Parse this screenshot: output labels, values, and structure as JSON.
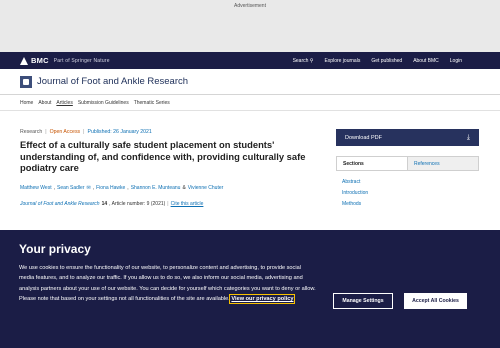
{
  "ad": {
    "label": "Advertisement"
  },
  "topbar": {
    "logo_text": "BMC",
    "logo_sub": "Part of Springer Nature",
    "nav": [
      {
        "label": "Search",
        "icon": "search-icon"
      },
      {
        "label": "Explore journals"
      },
      {
        "label": "Get published"
      },
      {
        "label": "About BMC"
      },
      {
        "label": "Login"
      }
    ]
  },
  "journal": {
    "title": "Journal of Foot and Ankle Research"
  },
  "subnav": {
    "items": [
      "Home",
      "About",
      "Articles",
      "Submission Guidelines",
      "Thematic Series"
    ],
    "active": "Articles"
  },
  "article": {
    "type": "Research",
    "access": "Open Access",
    "published": "Published: 26 January 2021",
    "title": "Effect of a culturally safe student placement on students' understanding of, and confidence with, providing culturally safe podiatry care",
    "authors": [
      "Matthew West",
      "Sean Sadler",
      "Fiona Hawke",
      "Shannon E. Munteanu",
      "Vivienne Chuter"
    ],
    "author_separator": ",",
    "author_and": "&",
    "journal_name": "Journal of Foot and Ankle Research",
    "volume": "14",
    "article_number": ", Article number: 9 (2021)",
    "cite_label": "Cite this article"
  },
  "sidebar": {
    "download_label": "Download PDF",
    "tabs": [
      "Sections",
      "References"
    ],
    "sections": [
      "Abstract",
      "Introduction",
      "Methods"
    ]
  },
  "cookie": {
    "title": "Your privacy",
    "text": "We use cookies to ensure the functionality of our website, to personalize content and advertising, to provide social media features, and to analyze our traffic. If you allow us to do so, we also inform our social media, advertising and analysis partners about your use of our website. You can decide for yourself which categories you want to deny or allow. Please note that based on your settings not all functionalities of the site are available.",
    "link_label": "View our privacy policy",
    "manage_label": "Manage Settings",
    "accept_label": "Accept All Cookies"
  },
  "colors": {
    "brand_navy": "#1b1d46",
    "link_blue": "#0c6fb3",
    "open_access_orange": "#c65301",
    "focus_yellow": "#f7c100"
  }
}
